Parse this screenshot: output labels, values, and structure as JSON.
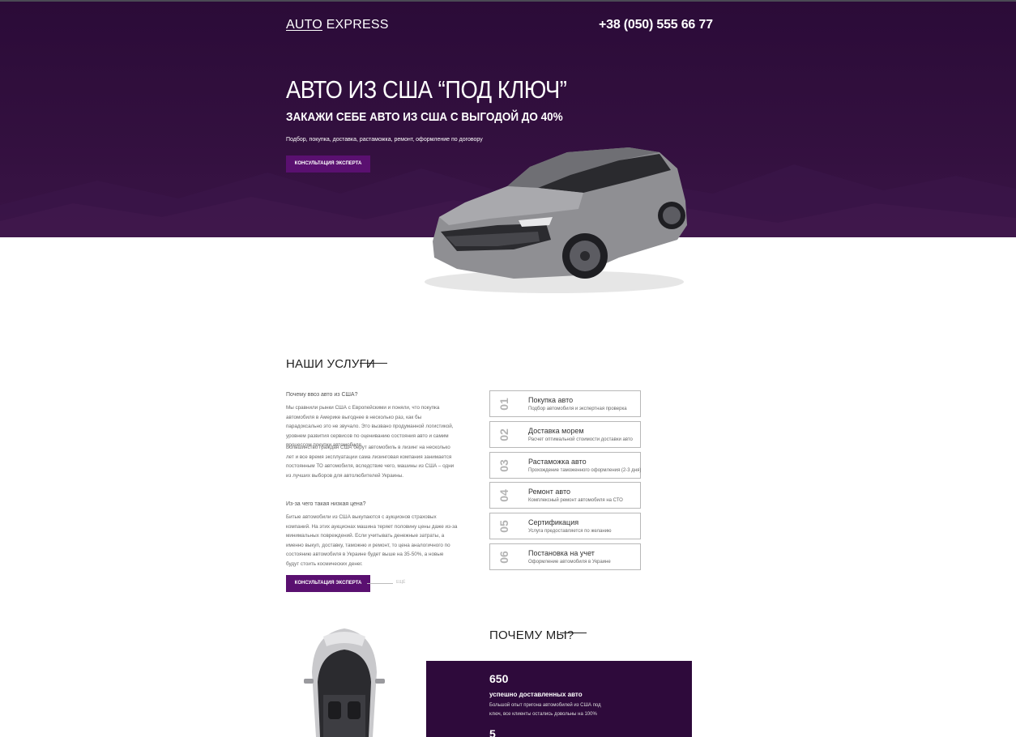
{
  "colors": {
    "hero_bg": "#2b0b38",
    "accent": "#5a1070",
    "stats_bg": "#2e0a3b"
  },
  "header": {
    "logo_part1": "AUTO",
    "logo_part2": " EXPRESS",
    "phone": "+38 (050) 555 66 77"
  },
  "hero": {
    "title": "АВТО ИЗ США “ПОД КЛЮЧ”",
    "subtitle": "ЗАКАЖИ СЕБЕ АВТО ИЗ США С ВЫГОДОЙ ДО 40%",
    "small": "Подбор, покупка, доставка, растаможка, ремонт, оформление по договору",
    "button": "КОНСУЛЬТАЦИЯ ЭКСПЕРТА"
  },
  "services": {
    "title": "НАШИ УСЛУГИ",
    "q1": "Почему ввоз авто из США?",
    "p1": "Мы сравнили рынки США с Европейскими и поняли, что покупка автомобиля в Америке выгоднее в несколько раз, как бы парадоксально это не звучало. Это вызвано продуманной логистикой, уровнем развития сервисов по оцениванию состояния авто и самим процессом покупки автомобиля.",
    "p2": "Большинство граждан США берут автомобиль в лизинг на несколько лет и все время эксплуатации сама лизинговая компания занимается постоянным ТО автомобиля, вследствие чего, машины из США – одни из лучших выборов для автолюбителей Украины.",
    "q2": "Из-за чего такая низкая цена?",
    "p3": "Битые автомобили из США выкупаются с аукционов страховых компаний. На этих аукционах машина теряет половину цены даже из-за минимальных повреждений. Если учитывать денежные затраты, а именно выкуп, доставку, таможню и ремонт, то цена аналогичного по состоянию автомобиля в Украине будет выше на 35-50%, а новые будут стоить космических денег.",
    "button": "КОНСУЛЬТАЦИЯ ЭКСПЕРТА",
    "button_note": "ЕЩЁ",
    "items": [
      {
        "num": "01",
        "name": "Покупка авто",
        "desc": "Подбор автомобиля и экспертная проверка"
      },
      {
        "num": "02",
        "name": "Доставка морем",
        "desc": "Расчет оптимальной стоимости доставки авто"
      },
      {
        "num": "03",
        "name": "Растаможка авто",
        "desc": "Прохождение таможенного оформления (2-3 дня)"
      },
      {
        "num": "04",
        "name": "Ремонт авто",
        "desc": "Комплексный ремонт автомобиля на СТО"
      },
      {
        "num": "05",
        "name": "Сертификация",
        "desc": "Услуга предоставляется по желанию"
      },
      {
        "num": "06",
        "name": "Постановка на учет",
        "desc": "Оформление автомобиля в Украине"
      }
    ]
  },
  "why": {
    "title": "ПОЧЕМУ МЫ?",
    "stat1_num": "650",
    "stat1_label": "успешно доставленных авто",
    "stat1_desc": "Большой опыт пригона автомобилей из США под ключ, все клиенты остались довольны на 100%",
    "stat2_num": "5"
  }
}
